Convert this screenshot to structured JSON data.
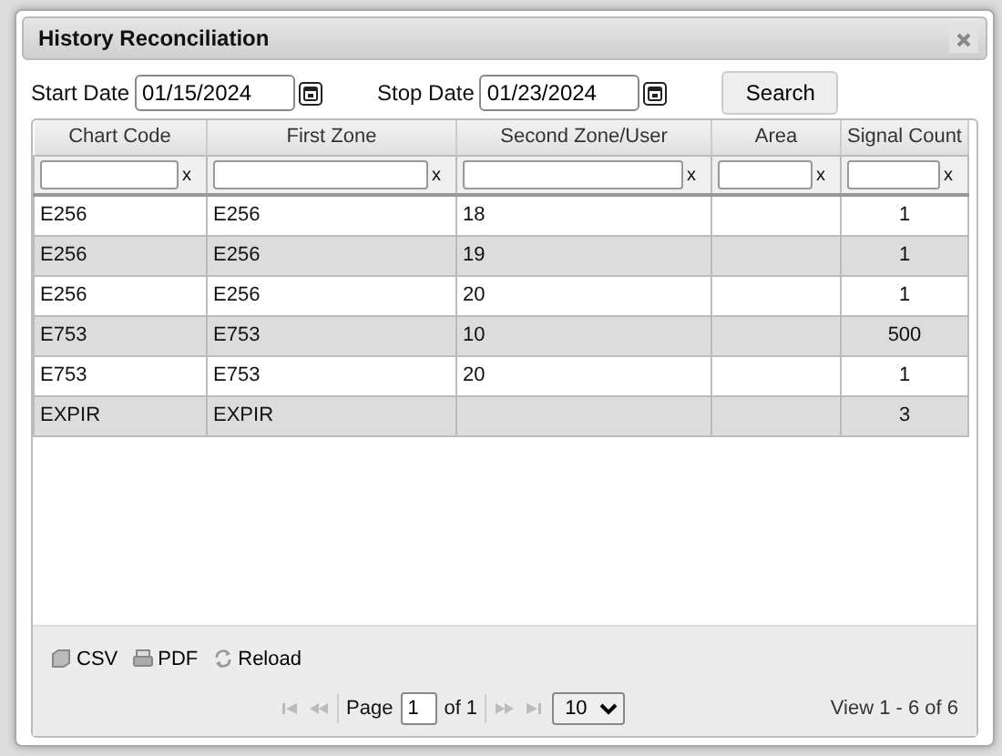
{
  "dialog": {
    "title": "History Reconciliation"
  },
  "filters": {
    "start_label": "Start Date",
    "start_value": "01/15/2024",
    "stop_label": "Stop Date",
    "stop_value": "01/23/2024",
    "search_button": "Search"
  },
  "table": {
    "columns": [
      {
        "label": "Chart Code",
        "clear_mark": "x"
      },
      {
        "label": "First Zone",
        "clear_mark": "x"
      },
      {
        "label": "Second Zone/User",
        "clear_mark": "x"
      },
      {
        "label": "Area",
        "clear_mark": "x"
      },
      {
        "label": "Signal Count",
        "clear_mark": "x"
      }
    ],
    "rows": [
      [
        "E256",
        "E256",
        "18",
        "",
        "1"
      ],
      [
        "E256",
        "E256",
        "19",
        "",
        "1"
      ],
      [
        "E256",
        "E256",
        "20",
        "",
        "1"
      ],
      [
        "E753",
        "E753",
        "10",
        "",
        "500"
      ],
      [
        "E753",
        "E753",
        "20",
        "",
        "1"
      ],
      [
        "EXPIR",
        "EXPIR",
        "",
        "",
        "3"
      ]
    ]
  },
  "toolbar": [
    {
      "kind": "csv",
      "label": "CSV"
    },
    {
      "kind": "pdf",
      "label": "PDF"
    },
    {
      "kind": "reload",
      "label": "Reload"
    }
  ],
  "pager": {
    "page_label": "Page",
    "page_value": "1",
    "of_label": "of 1",
    "page_size": "10",
    "view_text": "View 1 - 6 of 6"
  }
}
